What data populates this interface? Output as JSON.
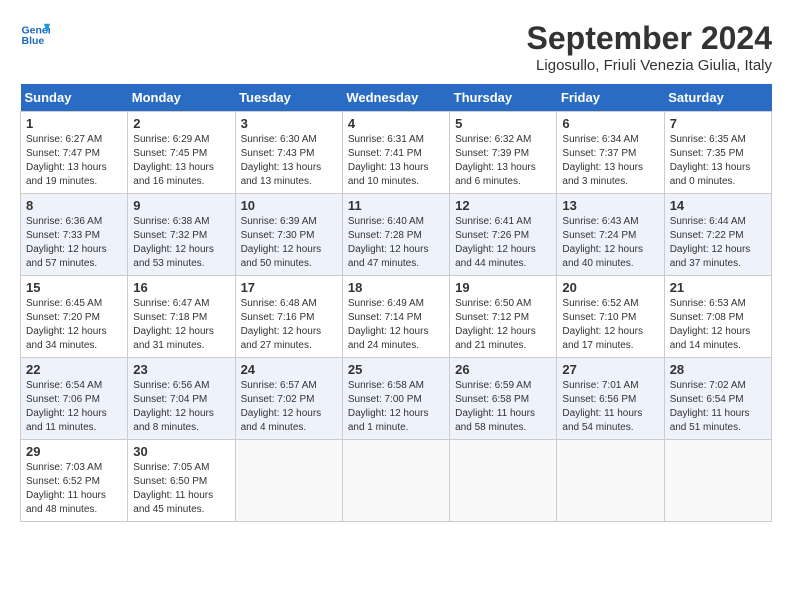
{
  "header": {
    "logo_line1": "General",
    "logo_line2": "Blue",
    "month": "September 2024",
    "location": "Ligosullo, Friuli Venezia Giulia, Italy"
  },
  "weekdays": [
    "Sunday",
    "Monday",
    "Tuesday",
    "Wednesday",
    "Thursday",
    "Friday",
    "Saturday"
  ],
  "weeks": [
    [
      {
        "day": "1",
        "sunrise": "6:27 AM",
        "sunset": "7:47 PM",
        "daylight": "13 hours and 19 minutes."
      },
      {
        "day": "2",
        "sunrise": "6:29 AM",
        "sunset": "7:45 PM",
        "daylight": "13 hours and 16 minutes."
      },
      {
        "day": "3",
        "sunrise": "6:30 AM",
        "sunset": "7:43 PM",
        "daylight": "13 hours and 13 minutes."
      },
      {
        "day": "4",
        "sunrise": "6:31 AM",
        "sunset": "7:41 PM",
        "daylight": "13 hours and 10 minutes."
      },
      {
        "day": "5",
        "sunrise": "6:32 AM",
        "sunset": "7:39 PM",
        "daylight": "13 hours and 6 minutes."
      },
      {
        "day": "6",
        "sunrise": "6:34 AM",
        "sunset": "7:37 PM",
        "daylight": "13 hours and 3 minutes."
      },
      {
        "day": "7",
        "sunrise": "6:35 AM",
        "sunset": "7:35 PM",
        "daylight": "13 hours and 0 minutes."
      }
    ],
    [
      {
        "day": "8",
        "sunrise": "6:36 AM",
        "sunset": "7:33 PM",
        "daylight": "12 hours and 57 minutes."
      },
      {
        "day": "9",
        "sunrise": "6:38 AM",
        "sunset": "7:32 PM",
        "daylight": "12 hours and 53 minutes."
      },
      {
        "day": "10",
        "sunrise": "6:39 AM",
        "sunset": "7:30 PM",
        "daylight": "12 hours and 50 minutes."
      },
      {
        "day": "11",
        "sunrise": "6:40 AM",
        "sunset": "7:28 PM",
        "daylight": "12 hours and 47 minutes."
      },
      {
        "day": "12",
        "sunrise": "6:41 AM",
        "sunset": "7:26 PM",
        "daylight": "12 hours and 44 minutes."
      },
      {
        "day": "13",
        "sunrise": "6:43 AM",
        "sunset": "7:24 PM",
        "daylight": "12 hours and 40 minutes."
      },
      {
        "day": "14",
        "sunrise": "6:44 AM",
        "sunset": "7:22 PM",
        "daylight": "12 hours and 37 minutes."
      }
    ],
    [
      {
        "day": "15",
        "sunrise": "6:45 AM",
        "sunset": "7:20 PM",
        "daylight": "12 hours and 34 minutes."
      },
      {
        "day": "16",
        "sunrise": "6:47 AM",
        "sunset": "7:18 PM",
        "daylight": "12 hours and 31 minutes."
      },
      {
        "day": "17",
        "sunrise": "6:48 AM",
        "sunset": "7:16 PM",
        "daylight": "12 hours and 27 minutes."
      },
      {
        "day": "18",
        "sunrise": "6:49 AM",
        "sunset": "7:14 PM",
        "daylight": "12 hours and 24 minutes."
      },
      {
        "day": "19",
        "sunrise": "6:50 AM",
        "sunset": "7:12 PM",
        "daylight": "12 hours and 21 minutes."
      },
      {
        "day": "20",
        "sunrise": "6:52 AM",
        "sunset": "7:10 PM",
        "daylight": "12 hours and 17 minutes."
      },
      {
        "day": "21",
        "sunrise": "6:53 AM",
        "sunset": "7:08 PM",
        "daylight": "12 hours and 14 minutes."
      }
    ],
    [
      {
        "day": "22",
        "sunrise": "6:54 AM",
        "sunset": "7:06 PM",
        "daylight": "12 hours and 11 minutes."
      },
      {
        "day": "23",
        "sunrise": "6:56 AM",
        "sunset": "7:04 PM",
        "daylight": "12 hours and 8 minutes."
      },
      {
        "day": "24",
        "sunrise": "6:57 AM",
        "sunset": "7:02 PM",
        "daylight": "12 hours and 4 minutes."
      },
      {
        "day": "25",
        "sunrise": "6:58 AM",
        "sunset": "7:00 PM",
        "daylight": "12 hours and 1 minute."
      },
      {
        "day": "26",
        "sunrise": "6:59 AM",
        "sunset": "6:58 PM",
        "daylight": "11 hours and 58 minutes."
      },
      {
        "day": "27",
        "sunrise": "7:01 AM",
        "sunset": "6:56 PM",
        "daylight": "11 hours and 54 minutes."
      },
      {
        "day": "28",
        "sunrise": "7:02 AM",
        "sunset": "6:54 PM",
        "daylight": "11 hours and 51 minutes."
      }
    ],
    [
      {
        "day": "29",
        "sunrise": "7:03 AM",
        "sunset": "6:52 PM",
        "daylight": "11 hours and 48 minutes."
      },
      {
        "day": "30",
        "sunrise": "7:05 AM",
        "sunset": "6:50 PM",
        "daylight": "11 hours and 45 minutes."
      },
      null,
      null,
      null,
      null,
      null
    ]
  ]
}
